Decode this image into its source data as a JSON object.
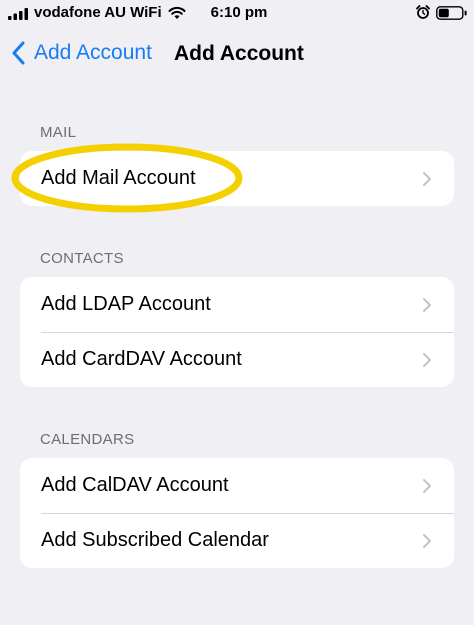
{
  "status_bar": {
    "carrier": "vodafone AU WiFi",
    "time": "6:10 pm"
  },
  "nav": {
    "back_label": "Add Account",
    "title": "Add Account"
  },
  "sections": {
    "mail": {
      "header": "MAIL",
      "items": [
        "Add Mail Account"
      ]
    },
    "contacts": {
      "header": "CONTACTS",
      "items": [
        "Add LDAP Account",
        "Add CardDAV Account"
      ]
    },
    "calendars": {
      "header": "CALENDARS",
      "items": [
        "Add CalDAV Account",
        "Add Subscribed Calendar"
      ]
    }
  },
  "colors": {
    "accent": "#1a7cf2",
    "highlight": "#f5d000",
    "background": "#efeff4"
  }
}
